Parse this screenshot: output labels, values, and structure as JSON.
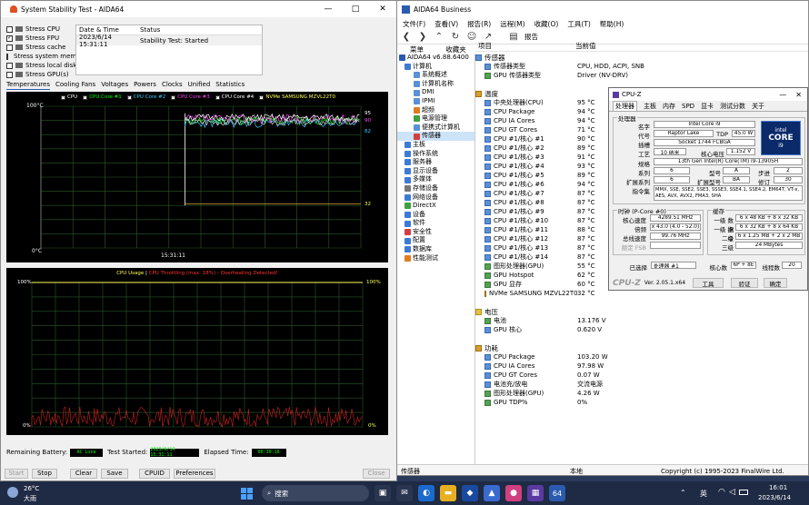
{
  "sst": {
    "title": "System Stability Test - AIDA64",
    "wmin": "—",
    "wmax": "□",
    "wclose": "✕",
    "checks": [
      {
        "label": "Stress CPU",
        "checked": false
      },
      {
        "label": "Stress FPU",
        "checked": true
      },
      {
        "label": "Stress cache",
        "checked": false
      },
      {
        "label": "Stress system memory",
        "checked": false
      },
      {
        "label": "Stress local disks",
        "checked": false
      },
      {
        "label": "Stress GPU(s)",
        "checked": false
      }
    ],
    "check_mark": "✓",
    "table": {
      "h_date": "Date & Time",
      "h_status": "Status",
      "date": "2023/6/14 15:31:11",
      "status": "Stability Test: Started"
    },
    "tabs": [
      "Temperatures",
      "Cooling Fans",
      "Voltages",
      "Powers",
      "Clocks",
      "Unified",
      "Statistics"
    ],
    "legend": [
      {
        "label": "CPU",
        "color": "#ffffff"
      },
      {
        "label": "CPU Core #1",
        "color": "#00ff00"
      },
      {
        "label": "CPU Core #2",
        "color": "#33ccff"
      },
      {
        "label": "CPU Core #3",
        "color": "#ff44ff"
      },
      {
        "label": "CPU Core #4",
        "color": "#ffffff"
      },
      {
        "label": "NVMe SAMSUNG MZVL22T0",
        "color": "#ffff55"
      }
    ],
    "temp_top": "100°C",
    "temp_bot": "0°C",
    "temp_time": "15:31:11",
    "temp_labels": [
      "95",
      "90",
      "82",
      "32"
    ],
    "usage_title1": "CPU Usage",
    "usage_sep": "|",
    "usage_title2": "CPU Throttling (max: 18%) - Overheating Detected!",
    "usage_top": "100%",
    "usage_bot": "0%",
    "usage_rtop": "100%",
    "usage_rbot": "0%",
    "info": {
      "battery_label": "Remaining Battery:",
      "battery": "AC Line",
      "started_label": "Test Started:",
      "started": "2023/6/14 15:31:11",
      "elapsed_label": "Elapsed Time:",
      "elapsed": "00:30:18"
    },
    "buttons": {
      "start": "Start",
      "stop": "Stop",
      "clear": "Clear",
      "save": "Save",
      "cpuid": "CPUID",
      "prefs": "Preferences",
      "close": "Close"
    }
  },
  "aida": {
    "title": "AIDA64 Business",
    "menu": [
      "文件(F)",
      "查看(V)",
      "报告(R)",
      "远程(M)",
      "收藏(O)",
      "工具(T)",
      "帮助(H)"
    ],
    "tool_report": "报告",
    "tabs": [
      "菜单",
      "收藏夹"
    ],
    "tree": [
      "AIDA64 v6.88.6400",
      "计算机",
      "系统概述",
      "计算机名称",
      "DMI",
      "IPMI",
      "超频",
      "电源管理",
      "便携式计算机",
      "传感器",
      "主板",
      "操作系统",
      "服务器",
      "显示设备",
      "多媒体",
      "存储设备",
      "网络设备",
      "DirectX",
      "设备",
      "软件",
      "安全性",
      "配置",
      "数据库",
      "性能测试"
    ],
    "col_item": "项目",
    "col_value": "当前值",
    "sensors_group": "传感器",
    "sensor_type_label": "传感器类型",
    "sensor_type": "CPU, HDD, ACPI, SNB",
    "gpu_sensor_label": "GPU 传感器类型",
    "gpu_sensor": "Driver  (NV-DRV)",
    "temp_group": "温度",
    "temps": [
      {
        "n": "中央处理器(CPU)",
        "v": "95 °C"
      },
      {
        "n": "CPU Package",
        "v": "94 °C"
      },
      {
        "n": "CPU IA Cores",
        "v": "94 °C"
      },
      {
        "n": "CPU GT Cores",
        "v": "71 °C"
      },
      {
        "n": "CPU #1/核心 #1",
        "v": "90 °C"
      },
      {
        "n": "CPU #1/核心 #2",
        "v": "89 °C"
      },
      {
        "n": "CPU #1/核心 #3",
        "v": "91 °C"
      },
      {
        "n": "CPU #1/核心 #4",
        "v": "93 °C"
      },
      {
        "n": "CPU #1/核心 #5",
        "v": "89 °C"
      },
      {
        "n": "CPU #1/核心 #6",
        "v": "94 °C"
      },
      {
        "n": "CPU #1/核心 #7",
        "v": "87 °C"
      },
      {
        "n": "CPU #1/核心 #8",
        "v": "87 °C"
      },
      {
        "n": "CPU #1/核心 #9",
        "v": "87 °C"
      },
      {
        "n": "CPU #1/核心 #10",
        "v": "87 °C"
      },
      {
        "n": "CPU #1/核心 #11",
        "v": "88 °C"
      },
      {
        "n": "CPU #1/核心 #12",
        "v": "87 °C"
      },
      {
        "n": "CPU #1/核心 #13",
        "v": "87 °C"
      },
      {
        "n": "CPU #1/核心 #14",
        "v": "87 °C"
      },
      {
        "n": "图形处理器(GPU)",
        "v": "55 °C"
      },
      {
        "n": "GPU Hotspot",
        "v": "62 °C"
      },
      {
        "n": "GPU 显存",
        "v": "60 °C"
      },
      {
        "n": "NVMe SAMSUNG MZVL22T0",
        "v": "32 °C"
      }
    ],
    "volt_group": "电压",
    "volts": [
      {
        "n": "电池",
        "v": "13.176 V"
      },
      {
        "n": "GPU 核心",
        "v": "0.620 V"
      }
    ],
    "power_group": "功耗",
    "powers": [
      {
        "n": "CPU Package",
        "v": "103.20 W"
      },
      {
        "n": "CPU IA Cores",
        "v": "97.98 W"
      },
      {
        "n": "CPU GT Cores",
        "v": "0.07 W"
      },
      {
        "n": "电池充/放电",
        "v": "交流电源"
      },
      {
        "n": "图形处理器(GPU)",
        "v": "4.26 W"
      },
      {
        "n": "GPU TDP%",
        "v": "0%"
      }
    ],
    "status_left": "传感器",
    "status_mid": "本地",
    "status_right": "Copyright (c) 1995-2023 FinalWire Ltd."
  },
  "cpuz": {
    "title": "CPU-Z",
    "tabs": [
      "处理器",
      "主板",
      "内存",
      "SPD",
      "显卡",
      "测试分数",
      "关于"
    ],
    "sec_proc": "处理器",
    "name_l": "名字",
    "name": "Intel Core i9",
    "code_l": "代号",
    "code": "Raptor Lake",
    "tdp_l": "TDP",
    "tdp": "45.0 W",
    "sock_l": "插槽",
    "sock": "Socket 1744 FCBGA",
    "tech_l": "工艺",
    "tech": "10 纳米",
    "volt_l": "核心电压",
    "volt": "1.152 V",
    "spec_l": "规格",
    "spec": "13th Gen Intel(R) Core(TM) i9-13905H",
    "fam_l": "系列",
    "fam": "6",
    "model_l": "型号",
    "model": "A",
    "step_l": "步进",
    "step": "2",
    "efam_l": "扩展系列",
    "efam": "6",
    "emodel_l": "扩展型号",
    "emodel": "BA",
    "rev_l": "修订",
    "rev": "30",
    "inst_l": "指令集",
    "inst": "MMX, SSE, SSE2, SSE3, SSSE3, SSE4.1, SSE4.2, EM64T, VT-x, AES, AVX, AVX2, FMA3, SHA",
    "logo1": "intel",
    "logo2": "CORE",
    "logo3": "i9",
    "sec_clock": "时钟 (P-Core #0)",
    "cspeed_l": "核心速度",
    "cspeed": "4289.51 MHz",
    "mult_l": "倍频",
    "mult": "x 43.0 (4.0 - 52.0)",
    "bus_l": "总线速度",
    "bus": "99.76 MHz",
    "fsb_l": "额定 FSB",
    "sec_cache": "缓存",
    "l1d_l": "一级 数据",
    "l1d": "6 x 48 KB + 8 x 32 KB",
    "l1i_l": "一级 指令",
    "l1i": "6 x 32 KB + 8 x 64 KB",
    "l2_l": "二级",
    "l2": "6 x 1.25 MB + 2 x 2 MB",
    "l3_l": "三级",
    "l3": "24 MBytes",
    "sel_l": "已选择",
    "sel": "处理器 #1",
    "cores_l": "核心数",
    "cores": "6P + 8E",
    "threads_l": "线程数",
    "threads": "20",
    "brand": "CPU-Z",
    "ver": "Ver. 2.05.1.x64",
    "tools": "工具",
    "validate": "验证",
    "ok": "确定"
  },
  "taskbar": {
    "weather_temp": "26°C",
    "weather_desc": "大雨",
    "search": "搜索",
    "ime": "英",
    "time": "16:01",
    "date": "2023/6/14"
  }
}
